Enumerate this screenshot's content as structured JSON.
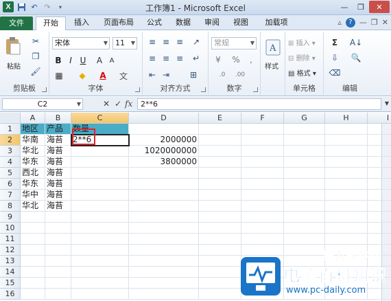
{
  "window": {
    "title": "工作簿1 - Microsoft Excel",
    "quick_access": [
      "save-icon",
      "undo-icon",
      "redo-icon",
      "customize-icon"
    ]
  },
  "ribbon_tabs": [
    "文件",
    "开始",
    "插入",
    "页面布局",
    "公式",
    "数据",
    "审阅",
    "视图",
    "加载项"
  ],
  "active_tab": "开始",
  "ribbon": {
    "clipboard": {
      "label": "剪贴板",
      "paste": "粘贴"
    },
    "font": {
      "label": "字体",
      "name": "宋体",
      "size": "11"
    },
    "alignment": {
      "label": "对齐方式"
    },
    "number": {
      "label": "数字",
      "format": "常规",
      "percent": "%",
      "comma": ","
    },
    "styles": {
      "label": "样式"
    },
    "cells": {
      "label": "单元格",
      "insert": "插入",
      "delete": "删除",
      "format": "格式"
    },
    "editing": {
      "label": "编辑"
    }
  },
  "formula_bar": {
    "name_box": "C2",
    "cancel": "✕",
    "enter": "✓",
    "fx": "fx",
    "formula": "2**6"
  },
  "columns": [
    "A",
    "B",
    "C",
    "D",
    "E",
    "F",
    "G",
    "H",
    "I"
  ],
  "rows": [
    "1",
    "2",
    "3",
    "4",
    "5",
    "6",
    "7",
    "8",
    "9",
    "10",
    "11",
    "12",
    "13",
    "14",
    "15",
    "16"
  ],
  "cells": {
    "A1": "地区",
    "B1": "产品",
    "C1": "数量",
    "A2": "华南",
    "B2": "海苔",
    "C2": "2**6",
    "D2": "2000000",
    "A3": "华北",
    "B3": "海苔",
    "D3": "1020000000",
    "A4": "华东",
    "B4": "海苔",
    "D4": "3800000",
    "A5": "西北",
    "B5": "海苔",
    "A6": "华东",
    "B6": "海苔",
    "A7": "华中",
    "B7": "海苔",
    "A8": "华北",
    "B8": "海苔"
  },
  "watermark": {
    "line1": "第九软件网",
    "line2": "电脑百科知识",
    "url": "www.pc-daily.com"
  },
  "colors": {
    "header_fill": "#4bacc6",
    "file_tab": "#217346",
    "highlight": "#e0242a"
  }
}
